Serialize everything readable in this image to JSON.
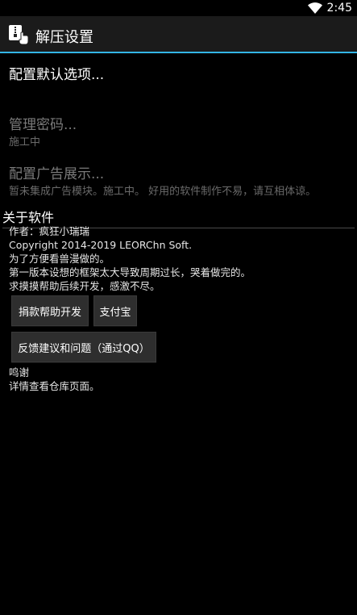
{
  "status_bar": {
    "time": "2:45"
  },
  "action_bar": {
    "title": "解压设置"
  },
  "preferences": [
    {
      "title": "配置默认选项...",
      "summary": "",
      "enabled": true
    },
    {
      "title": "管理密码...",
      "summary": "施工中",
      "enabled": false
    },
    {
      "title": "配置广告展示...",
      "summary": "暂未集成广告模块。施工中。 好用的软件制作不易，请互相体谅。",
      "enabled": false
    }
  ],
  "about": {
    "category": "关于软件",
    "lines": [
      "作者：疯狂小瑞瑞",
      "Copyright 2014-2019 LEORChn Soft.",
      "为了方便看兽漫做的。",
      "第一版本设想的框架太大导致周期过长，哭着做完的。",
      "求摸摸帮助后续开发，感激不尽。"
    ],
    "buttons": {
      "donate": "捐款帮助开发",
      "alipay": "支付宝",
      "feedback": "反馈建议和问题（通过QQ）"
    },
    "thanks_lines": [
      "鸣谢",
      "详情查看仓库页面。"
    ]
  }
}
